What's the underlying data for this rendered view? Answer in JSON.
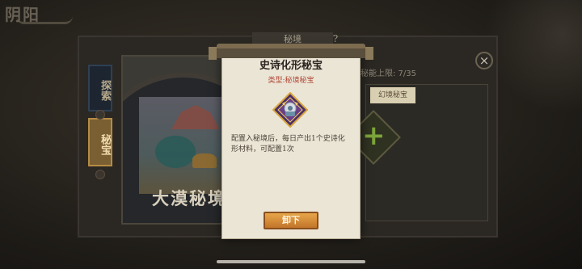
{
  "app": {
    "logo_text": "阴阳"
  },
  "resources": {
    "left": "",
    "right": ""
  },
  "panel": {
    "header": "秘境"
  },
  "side_tabs": [
    {
      "label": "探索"
    },
    {
      "label": "秘宝"
    }
  ],
  "scene": {
    "title": "大漠秘境"
  },
  "right": {
    "limit": "秘能上限: 7/35",
    "tab_label": "幻境秘宝",
    "bottom_text": ""
  },
  "popup": {
    "title": "史诗化形秘宝",
    "type": "类型:秘境秘宝",
    "description": "配置入秘境后，每日产出1个史诗化形材料，可配置1次",
    "button_label": "卸下"
  },
  "icons": {
    "close": "×",
    "help": "?",
    "add": "+"
  },
  "colors": {
    "accent": "#c2752a",
    "type_text": "#b04838",
    "add": "#7ca53a"
  }
}
